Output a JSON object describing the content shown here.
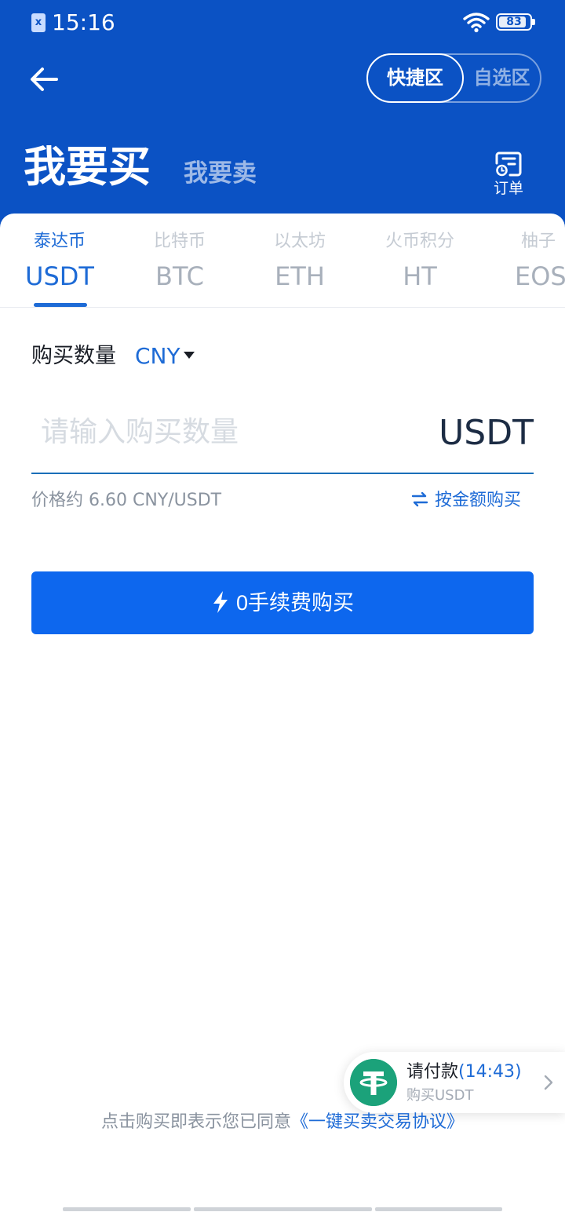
{
  "status_bar": {
    "time": "15:16",
    "battery": "83",
    "sim_badge": "x"
  },
  "header": {
    "segments": [
      "快捷区",
      "自选区"
    ],
    "buy_title": "我要买",
    "sell_title": "我要卖",
    "orders_label": "订单"
  },
  "coin_tabs": [
    {
      "cn": "泰达币",
      "symbol": "USDT"
    },
    {
      "cn": "比特币",
      "symbol": "BTC"
    },
    {
      "cn": "以太坊",
      "symbol": "ETH"
    },
    {
      "cn": "火币积分",
      "symbol": "HT"
    },
    {
      "cn": "柚子",
      "symbol": "EOS"
    }
  ],
  "form": {
    "qty_label": "购买数量",
    "currency": "CNY",
    "amount_placeholder": "请输入购买数量",
    "unit": "USDT",
    "price_text": "价格约 6.60 CNY/USDT",
    "switch_label": "按金额购买"
  },
  "buy_button": "0手续费购买",
  "agreement": {
    "prefix": "点击购买即表示您已同意",
    "link": "《一键买卖交易协议》"
  },
  "pay_widget": {
    "title": "请付款",
    "timer": "(14:43)",
    "subtitle": "购买USDT"
  },
  "colors": {
    "brand_blue": "#0b52c4",
    "accent_blue": "#1e6bd6",
    "button_blue": "#0d67ee",
    "tether_green": "#1ba27a"
  }
}
